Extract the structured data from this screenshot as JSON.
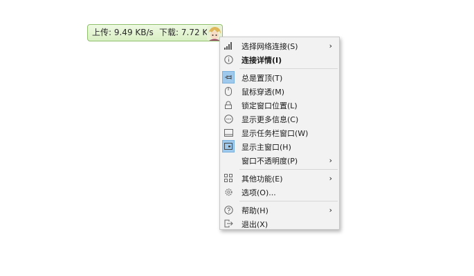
{
  "speed_widget": {
    "upload_text": "上传: 9.49 KB/s",
    "download_text": "下载: 7.72 KB/s"
  },
  "menu": {
    "items": [
      {
        "label": "选择网络连接(S)",
        "icon": "signal-bars-icon",
        "submenu": true
      },
      {
        "label": "连接详情(I)",
        "icon": "info-icon",
        "bold": true
      },
      {
        "label": "总是置顶(T)",
        "icon": "pin-icon",
        "checked": true
      },
      {
        "label": "鼠标穿透(M)",
        "icon": "mouse-icon"
      },
      {
        "label": "锁定窗口位置(L)",
        "icon": "lock-icon"
      },
      {
        "label": "显示更多信息(C)",
        "icon": "more-icon"
      },
      {
        "label": "显示任务栏窗口(W)",
        "icon": "taskbar-icon"
      },
      {
        "label": "显示主窗口(H)",
        "icon": "main-window-icon",
        "checked": true
      },
      {
        "label": "窗口不透明度(P)",
        "icon": "",
        "submenu": true
      },
      {
        "label": "其他功能(E)",
        "icon": "grid-icon",
        "submenu": true
      },
      {
        "label": "选项(O)...",
        "icon": "gear-icon"
      },
      {
        "label": "帮助(H)",
        "icon": "help-icon",
        "submenu": true
      },
      {
        "label": "退出(X)",
        "icon": "exit-icon"
      }
    ],
    "submenu_arrow": "›"
  },
  "colors": {
    "widget_border": "#8fbf6a",
    "widget_bg": "#e4f4d4",
    "menu_bg": "#f2f2f2",
    "checked_bg": "#9fc9ec"
  }
}
